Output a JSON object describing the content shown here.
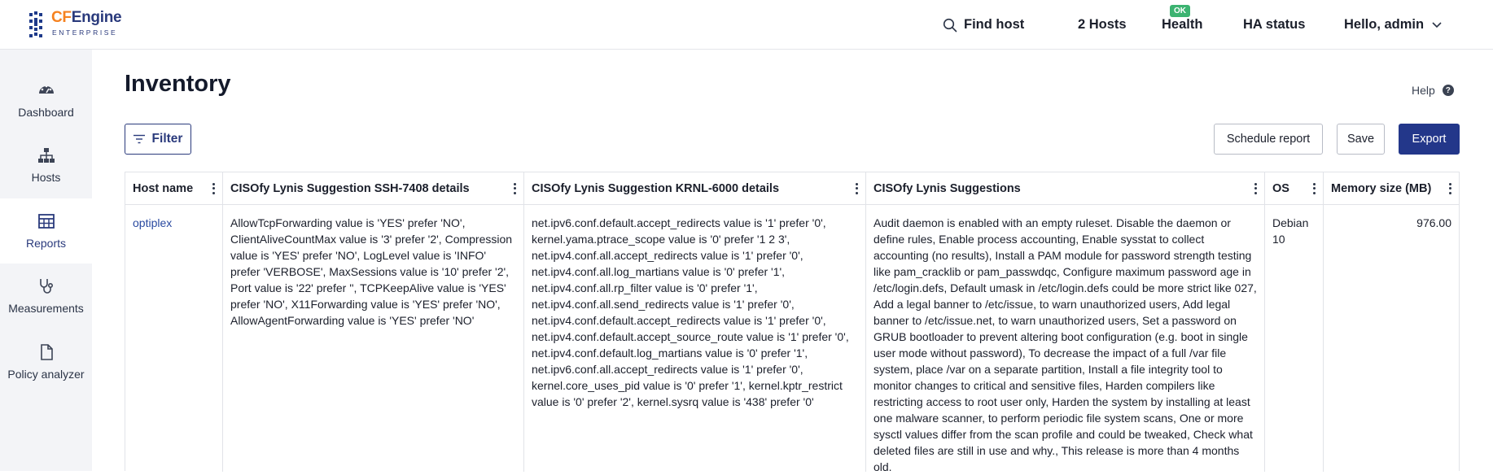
{
  "brand": {
    "name_part1": "CF",
    "name_part2": "Engine",
    "subtitle": "ENTERPRISE"
  },
  "topnav": {
    "find_host": "Find host",
    "hosts_count": "2 Hosts",
    "health": "Health",
    "health_badge": "OK",
    "ha_status": "HA status",
    "user_greeting": "Hello, admin"
  },
  "sidebar": {
    "items": [
      {
        "label": "Dashboard",
        "icon": "dashboard-gauge-icon"
      },
      {
        "label": "Hosts",
        "icon": "hierarchy-icon"
      },
      {
        "label": "Reports",
        "icon": "table-icon",
        "active": true
      },
      {
        "label": "Measurements",
        "icon": "stethoscope-icon"
      },
      {
        "label": "Policy analyzer",
        "icon": "document-icon"
      }
    ]
  },
  "page": {
    "title": "Inventory",
    "help": "Help",
    "help_icon": "?"
  },
  "toolbar": {
    "filter": "Filter",
    "schedule_report": "Schedule report",
    "save": "Save",
    "export": "Export"
  },
  "colors": {
    "accent": "#23378a",
    "ok": "#3cb371",
    "brand_orange": "#f58220"
  },
  "table": {
    "columns": [
      "Host name",
      "CISOfy Lynis Suggestion SSH-7408 details",
      "CISOfy Lynis Suggestion KRNL-6000 details",
      "CISOfy Lynis Suggestions",
      "OS",
      "Memory size (MB)"
    ],
    "rows": [
      {
        "host": "optiplex",
        "ssh": "AllowTcpForwarding value is 'YES' prefer 'NO', ClientAliveCountMax value is '3' prefer '2', Compression value is 'YES' prefer 'NO', LogLevel value is 'INFO' prefer 'VERBOSE', MaxSessions value is '10' prefer '2', Port value is '22' prefer '', TCPKeepAlive value is 'YES' prefer 'NO', X11Forwarding value is 'YES' prefer 'NO', AllowAgentForwarding value is 'YES' prefer 'NO'",
        "krnl": "net.ipv6.conf.default.accept_redirects value is '1' prefer '0', kernel.yama.ptrace_scope value is '0' prefer '1 2 3', net.ipv4.conf.all.accept_redirects value is '1' prefer '0', net.ipv4.conf.all.log_martians value is '0' prefer '1', net.ipv4.conf.all.rp_filter value is '0' prefer '1', net.ipv4.conf.all.send_redirects value is '1' prefer '0', net.ipv4.conf.default.accept_redirects value is '1' prefer '0', net.ipv4.conf.default.accept_source_route value is '1' prefer '0', net.ipv4.conf.default.log_martians value is '0' prefer '1', net.ipv6.conf.all.accept_redirects value is '1' prefer '0', kernel.core_uses_pid value is '0' prefer '1', kernel.kptr_restrict value is '0' prefer '2', kernel.sysrq value is '438' prefer '0'",
        "suggestions": "Audit daemon is enabled with an empty ruleset. Disable the daemon or define rules, Enable process accounting, Enable sysstat to collect accounting (no results), Install a PAM module for password strength testing like pam_cracklib or pam_passwdqc, Configure maximum password age in /etc/login.defs, Default umask in /etc/login.defs could be more strict like 027, Add a legal banner to /etc/issue, to warn unauthorized users, Add legal banner to /etc/issue.net, to warn unauthorized users, Set a password on GRUB bootloader to prevent altering boot configuration (e.g. boot in single user mode without password), To decrease the impact of a full /var file system, place /var on a separate partition, Install a file integrity tool to monitor changes to critical and sensitive files, Harden compilers like restricting access to root user only, Harden the system by installing at least one malware scanner, to perform periodic file system scans, One or more sysctl values differ from the scan profile and could be tweaked, Check what deleted files are still in use and why., This release is more than 4 months old.",
        "os": "Debian 10",
        "memory": "976.00"
      }
    ]
  }
}
